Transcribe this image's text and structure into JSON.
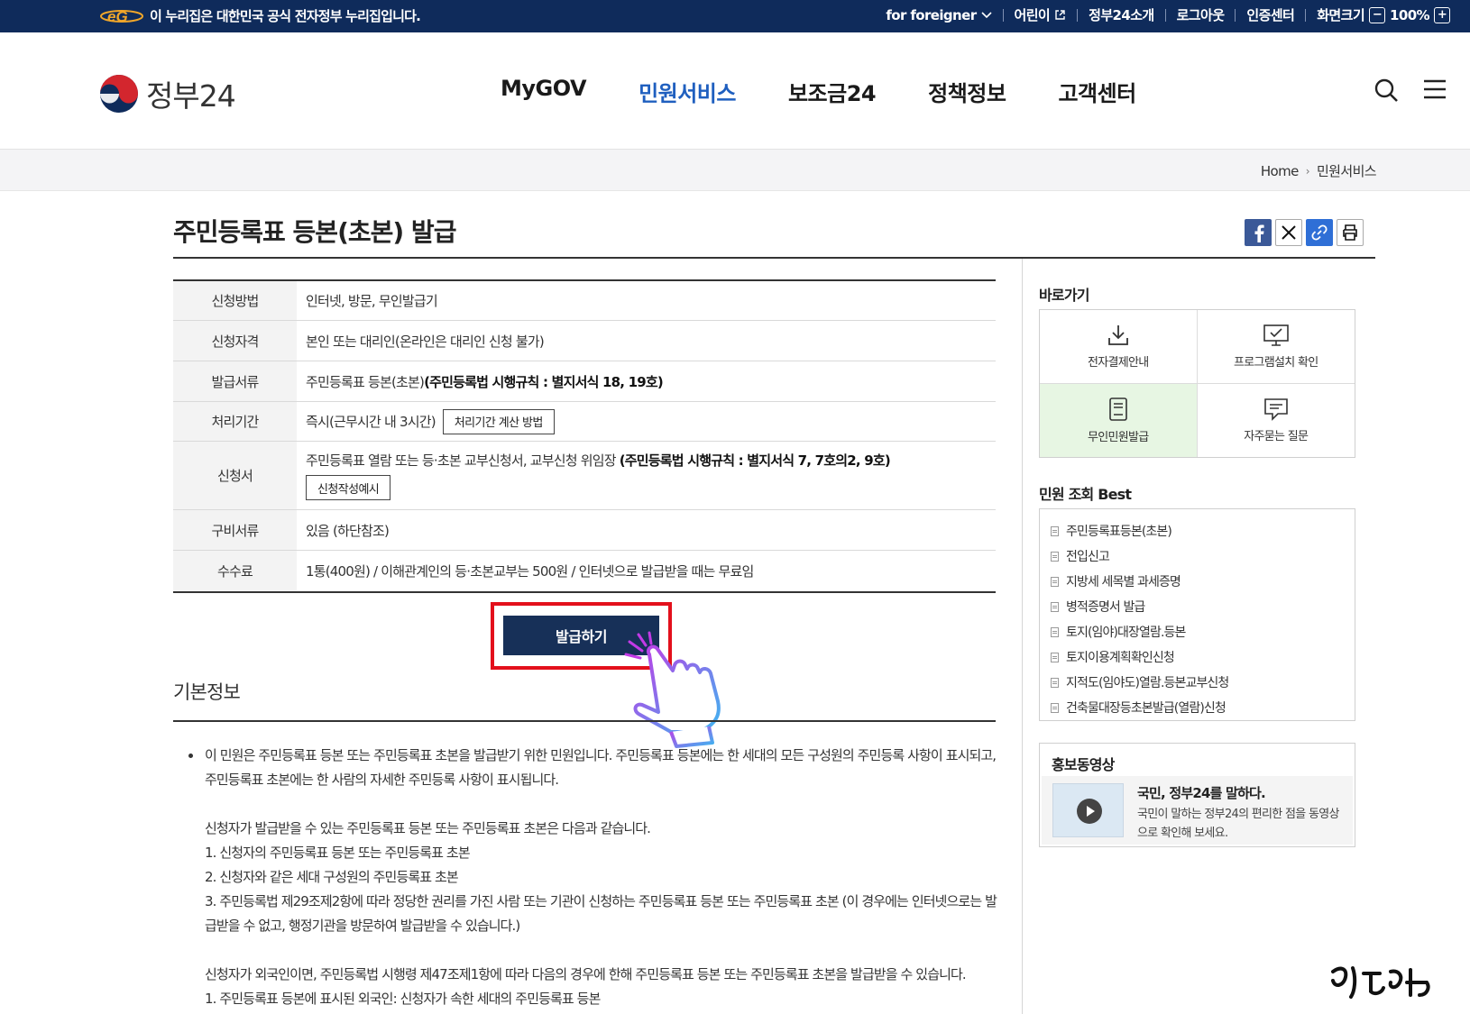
{
  "gov_bar": {
    "notice": "이 누리집은 대한민국 공식 전자정부 누리집입니다.",
    "foreigner": "for foreigner",
    "kids": "어린이",
    "about": "정부24소개",
    "logout": "로그아웃",
    "cert": "인증센터",
    "zoom_label": "화면크기",
    "zoom_value": "100%"
  },
  "header": {
    "logo_text": "정부24",
    "menu": [
      "MyGOV",
      "민원서비스",
      "보조금24",
      "정책정보",
      "고객센터"
    ],
    "active_menu": "민원서비스"
  },
  "breadcrumb": [
    "Home",
    "민원서비스"
  ],
  "page_title": "주민등록표 등본(초본) 발급",
  "info_table": [
    {
      "label": "신청방법",
      "value": "인터넷, 방문, 무인발급기"
    },
    {
      "label": "신청자격",
      "value": "본인 또는 대리인(온라인은 대리인 신청 불가)"
    },
    {
      "label": "발급서류",
      "value": "주민등록표 등본(초본) ",
      "bold": "(주민등록법 시행규칙 : 별지서식 18, 19호)"
    },
    {
      "label": "처리기간",
      "value": "즉시(근무시간 내 3시간)",
      "button": "처리기간 계산 방법"
    },
    {
      "label": "신청서",
      "value": "주민등록표 열람 또는 등·초본 교부신청서, 교부신청 위임장 ",
      "bold": "(주민등록법 시행규칙 : 별지서식 7, 7호의2, 9호)",
      "button": "신청작성예시"
    },
    {
      "label": "구비서류",
      "value": "있음 (하단참조)"
    },
    {
      "label": "수수료",
      "value": "1통(400원) / 이해관계인의 등·초본교부는 500원 / 인터넷으로 발급받을 때는 무료임"
    }
  ],
  "issue_button": "발급하기",
  "basic_info": {
    "title": "기본정보",
    "para1": "이 민원은 주민등록표 등본 또는 주민등록표 초본을 발급받기 위한 민원입니다. 주민등록표 등본에는 한 세대의 모든 구성원의 주민등록 사항이 표시되고, 주민등록표 초본에는 한 사람의 자세한 주민등록 사항이 표시됩니다.",
    "para2": "신청자가 발급받을 수 있는 주민등록표 등본 또는 주민등록표 초본은 다음과 같습니다.",
    "items": [
      "1. 신청자의 주민등록표 등본 또는 주민등록표 초본",
      "2. 신청자와 같은 세대 구성원의 주민등록표 초본",
      "3. 주민등록법 제29조제2항에 따라 정당한 권리를 가진 사람 또는 기관이 신청하는 주민등록표 등본 또는 주민등록표 초본 (이 경우에는 인터넷으로는 발급받을 수 없고, 행정기관을 방문하여 발급받을 수 있습니다.)"
    ],
    "para3": "신청자가 외국인이면, 주민등록법 시행령 제47조제1항에 따라 다음의 경우에 한해 주민등록표 등본 또는 주민등록표 초본을 발급받을 수 있습니다.",
    "items2": [
      "1. 주민등록표 등본에 표시된 외국인: 신청자가 속한 세대의 주민등록표 등본"
    ]
  },
  "sidebar": {
    "quick_title": "바로가기",
    "quick": [
      {
        "label": "전자결제안내",
        "icon": "download-icon"
      },
      {
        "label": "프로그램설치 확인",
        "icon": "monitor-check-icon"
      },
      {
        "label": "무인민원발급",
        "icon": "kiosk-icon"
      },
      {
        "label": "자주묻는 질문",
        "icon": "faq-chat-icon"
      }
    ],
    "best_title": "민원 조회 Best",
    "best": [
      "주민등록표등본(초본)",
      "전입신고",
      "지방세 세목별 과세증명",
      "병적증명서 발급",
      "토지(임야)대장열람.등본",
      "토지이용계획확인신청",
      "지적도(임야도)열람.등본교부신청",
      "건축물대장등초본발급(열람)신청"
    ],
    "promo_title": "홍보동영상",
    "promo_headline": "국민, 정부24를 말하다.",
    "promo_desc": "국민이 말하는 정부24의 편리한 점을 동영상으로 확인해 보세요."
  },
  "colors": {
    "navy": "#0f2b5b",
    "active": "#1f5fbf",
    "button": "#173058",
    "highlight": "#e3101c",
    "kiosk_bg": "#e7f6e3"
  }
}
